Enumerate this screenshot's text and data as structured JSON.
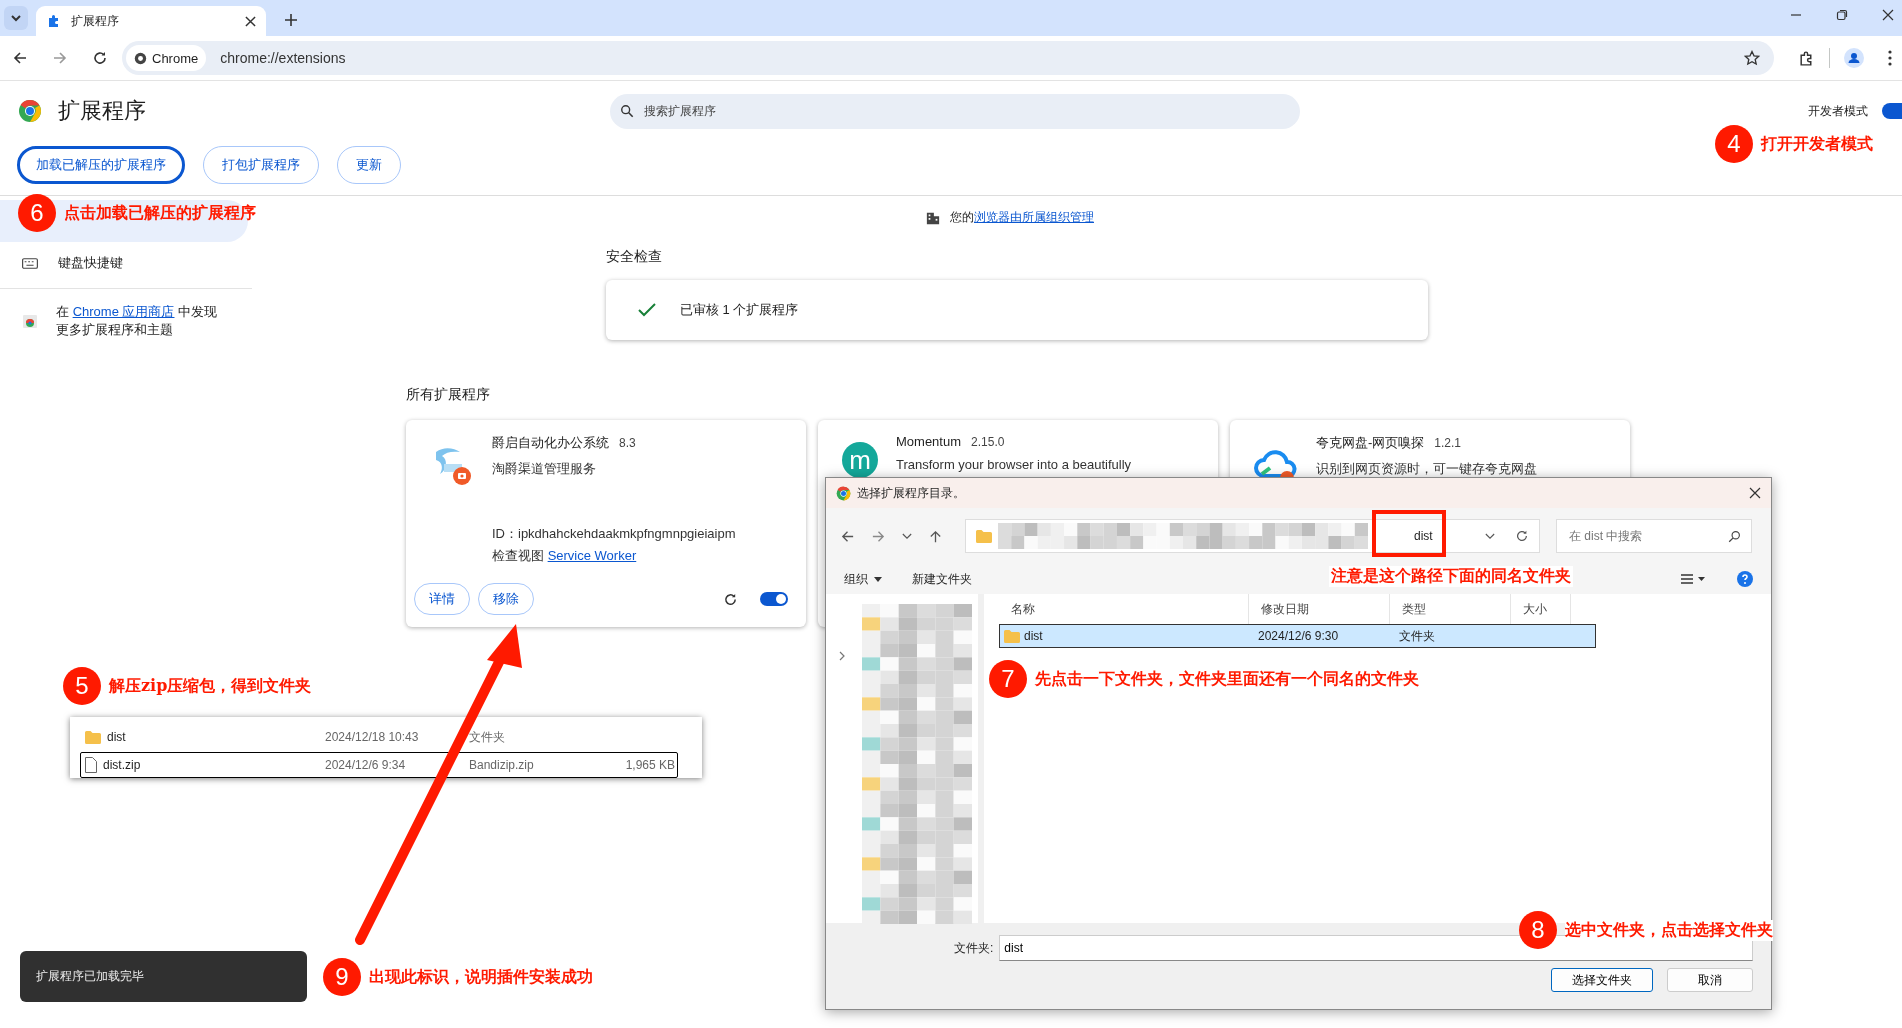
{
  "browser": {
    "tab_title": "扩展程序",
    "address_chip": "Chrome",
    "url": "chrome://extensions"
  },
  "header": {
    "title": "扩展程序",
    "search_placeholder": "搜索扩展程序",
    "dev_mode_label": "开发者模式",
    "dev_mode_on": true
  },
  "toolbar_buttons": [
    {
      "label": "加载已解压的扩展程序",
      "focused": true
    },
    {
      "label": "打包扩展程序",
      "focused": false
    },
    {
      "label": "更新",
      "focused": false
    }
  ],
  "sidebar": {
    "items": [
      {
        "label": "键盘快捷键"
      }
    ],
    "store_prefix": "在 ",
    "store_link": "Chrome 应用商店",
    "store_suffix": " 中发现更多扩展程序和主题"
  },
  "managed": {
    "prefix": "您的",
    "link": "浏览器由所属组织管理"
  },
  "safety": {
    "heading": "安全检查",
    "text": "已审核 1 个扩展程序"
  },
  "all_heading": "所有扩展程序",
  "extensions": [
    {
      "kind": "logo",
      "name": "爵启自动化办公系统",
      "version": "8.3",
      "description": "淘爵渠道管理服务",
      "id_label": "ID：",
      "id": "ipkdhahckehdaakmkpfngmnpgieiaipm",
      "views_label": "检查视图",
      "views_link": "Service Worker",
      "buttons": [
        "详情",
        "移除"
      ],
      "enabled": true
    },
    {
      "kind": "letter",
      "icon_text": "m",
      "name": "Momentum",
      "version": "2.15.0",
      "description": "Transform your browser into a beautifully"
    },
    {
      "kind": "cloud",
      "name": "夸克网盘-网页嗅探",
      "version": "1.2.1",
      "description": "识别到网页资源时，可一键存夸克网盘"
    }
  ],
  "dialog": {
    "title": "选择扩展程序目录。",
    "current_folder": "dist",
    "search_placeholder": "在 dist 中搜索",
    "organize": "组织",
    "new_folder": "新建文件夹",
    "columns": [
      "名称",
      "修改日期",
      "类型",
      "大小"
    ],
    "rows": [
      {
        "name": "dist",
        "date": "2024/12/6 9:30",
        "type": "文件夹",
        "selected": true
      }
    ],
    "folder_label": "文件夹:",
    "folder_value": "dist",
    "buttons": [
      "选择文件夹",
      "取消"
    ]
  },
  "explorer_snippet": {
    "rows": [
      {
        "kind": "folder",
        "name": "dist",
        "date": "2024/12/18 10:43",
        "type": "文件夹",
        "focused": false
      },
      {
        "kind": "file",
        "name": "dist.zip",
        "date": "2024/12/6 9:34",
        "type": "Bandizip.zip",
        "size": "1,965 KB",
        "focused": true
      }
    ]
  },
  "toast": "扩展程序已加载完毕",
  "annotations": [
    {
      "number": "4",
      "text": "打开开发者模式"
    },
    {
      "number": "6",
      "text": "点击加载已解压的扩展程序"
    },
    {
      "number": "5",
      "text": "解压zip压缩包，得到文件夹"
    },
    {
      "number": "7",
      "text": "先点击一下文件夹，文件夹里面还有一个同名的文件夹"
    },
    {
      "number": "8",
      "text": "选中文件夹，点击选择文件夹"
    },
    {
      "number": "9",
      "text": "出现此标识，说明插件安装成功"
    }
  ],
  "dialog_note": "注意是这个路径下面的同名文件夹"
}
